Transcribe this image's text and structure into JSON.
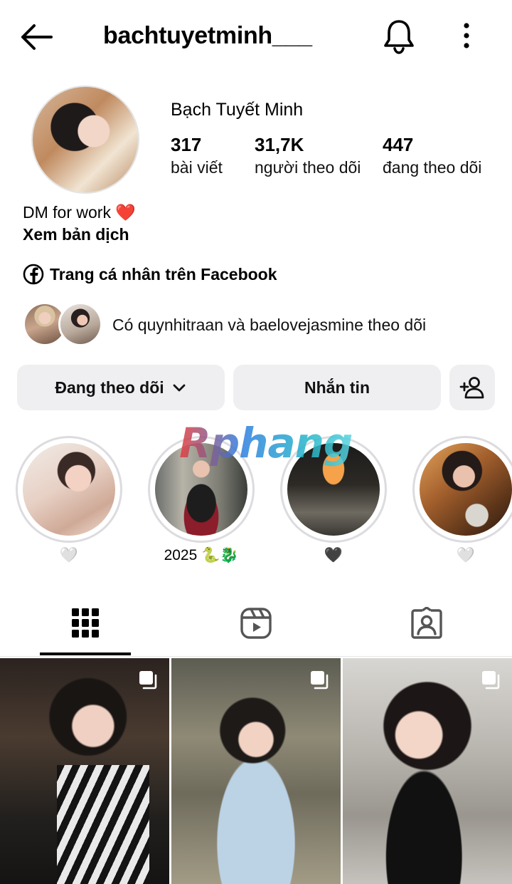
{
  "header": {
    "username": "bachtuyetminh___",
    "icons": [
      "arrow-left-icon",
      "bell-icon",
      "more-vertical-icon"
    ]
  },
  "profile": {
    "display_name": "Bạch Tuyết Minh",
    "stats": [
      {
        "value": "317",
        "label": "bài viết"
      },
      {
        "value": "31,7K",
        "label": "người theo dõi"
      },
      {
        "value": "447",
        "label": "đang theo dõi"
      }
    ],
    "bio": "DM for work ❤️",
    "translate": "Xem bản dịch",
    "facebook_link": "Trang cá nhân trên Facebook",
    "followed_by": "Có quynhitraan và baelovejasmine theo dõi"
  },
  "actions": {
    "following": "Đang theo dõi",
    "message": "Nhắn tin"
  },
  "watermark": "Rphang",
  "highlights": [
    {
      "label": "🤍"
    },
    {
      "label": "2025 🐍🐉"
    },
    {
      "label": "🖤"
    },
    {
      "label": "🤍"
    }
  ],
  "tabs": [
    {
      "icon": "grid-icon",
      "active": true
    },
    {
      "icon": "reels-icon",
      "active": false
    },
    {
      "icon": "tagged-icon",
      "active": false
    }
  ],
  "posts": [
    {
      "type": "carousel"
    },
    {
      "type": "carousel"
    },
    {
      "type": "carousel"
    }
  ],
  "colors": {
    "button_bg": "#efeff2",
    "active_tab": "#000000",
    "ring": "#dcdce0"
  }
}
